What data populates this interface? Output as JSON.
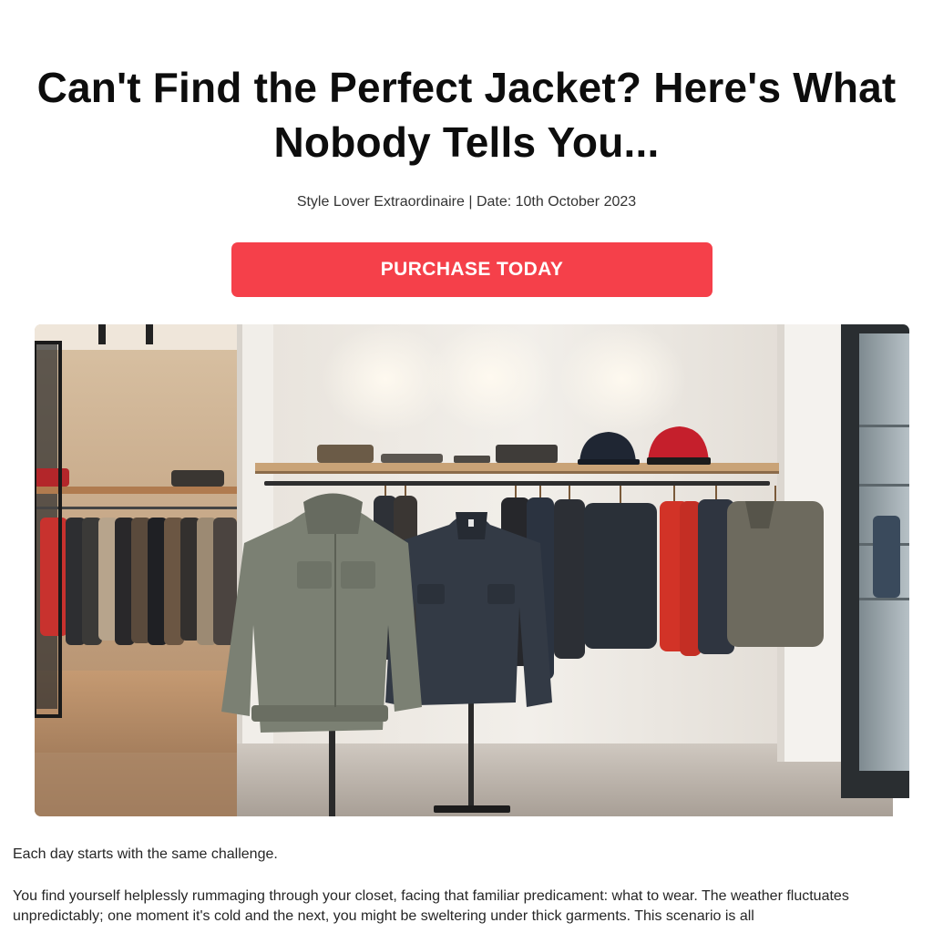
{
  "article": {
    "headline": "Can't Find the Perfect Jacket? Here's What Nobody Tells You...",
    "byline": "Style Lover Extraordinaire | Date: 10th October 2023",
    "cta_label": "PURCHASE TODAY",
    "paragraphs": [
      "Each day starts with the same challenge.",
      "You find yourself helplessly rummaging through your closet, facing that familiar predicament: what to wear. The weather fluctuates unpredictably; one moment it's cold and the next, you might be sweltering under thick garments. This scenario is all"
    ]
  },
  "colors": {
    "cta_background": "#f5404a",
    "cta_text": "#ffffff",
    "headline": "#0d0d0d",
    "body_text": "#262626"
  }
}
